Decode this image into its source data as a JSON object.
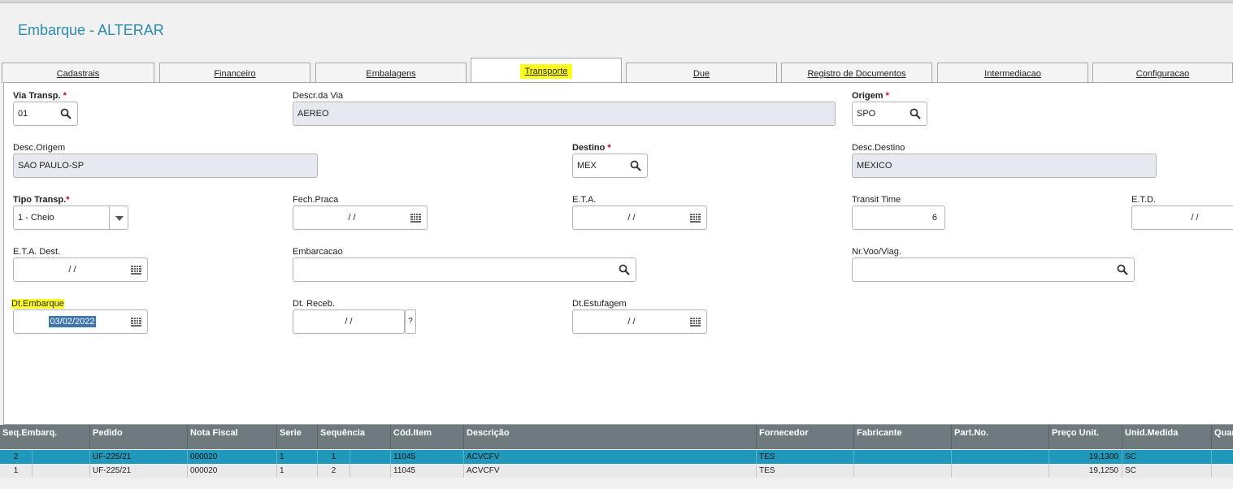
{
  "window": {
    "title": "Embarque - ALTERAR"
  },
  "tabs": [
    {
      "label": "Cadastrais"
    },
    {
      "label": "Financeiro"
    },
    {
      "label": "Embalagens"
    },
    {
      "label": "Transporte"
    },
    {
      "label": "Due"
    },
    {
      "label": "Registro de Documentos"
    },
    {
      "label": "Intermediacao"
    },
    {
      "label": "Configuracao"
    }
  ],
  "form": {
    "via_transp": {
      "label": "Via Transp.",
      "required": "*",
      "value": "01"
    },
    "descr_via": {
      "label": "Descr.da Via",
      "value": "AEREO"
    },
    "origem": {
      "label": "Origem",
      "required": "*",
      "value": "SPO"
    },
    "desc_origem": {
      "label": "Desc.Origem",
      "value": "SAO PAULO-SP"
    },
    "destino": {
      "label": "Destino",
      "required": "*",
      "value": "MEX"
    },
    "desc_destino": {
      "label": "Desc.Destino",
      "value": "MEXICO"
    },
    "tipo_transp": {
      "label": "Tipo Transp.",
      "required": "*",
      "value": "1 - Cheio"
    },
    "fech_praca": {
      "label": "Fech.Praca",
      "value": "/ /"
    },
    "eta": {
      "label": "E.T.A.",
      "value": "/ /"
    },
    "transit_time": {
      "label": "Transit Time",
      "value": "6"
    },
    "etd": {
      "label": "E.T.D.",
      "value": "/ /"
    },
    "eta_dest": {
      "label": "E.T.A. Dest.",
      "value": "/ /"
    },
    "embarcacao": {
      "label": "Embarcacao",
      "value": ""
    },
    "nr_voo": {
      "label": "Nr.Voo/Viag.",
      "value": ""
    },
    "dt_embarque": {
      "label": "Dt.Embarque",
      "value": "03/02/2022"
    },
    "dt_receb": {
      "label": "Dt. Receb.",
      "value": "/ /",
      "help": "?"
    },
    "dt_estufagem": {
      "label": "Dt.Estufagem",
      "value": "/ /"
    }
  },
  "grid": {
    "columns": [
      "Seq.Embarq.",
      "Pedido",
      "Nota Fiscal",
      "Serie",
      "Sequência",
      "Cód.Item",
      "Descrição",
      "Fornecedor",
      "Fabricante",
      "Part.No.",
      "Preço Unit.",
      "Unid.Medida",
      "Quan"
    ],
    "rows": [
      [
        "2",
        "UF-225/21",
        "000020",
        "1",
        "1",
        "11045",
        "ACVCFV",
        "TES",
        "",
        "",
        "19,1300",
        "SC",
        ""
      ],
      [
        "1",
        "UF-225/21",
        "000020",
        "1",
        "2",
        "11045",
        "ACVCFV",
        "TES",
        "",
        "",
        "19,1250",
        "SC",
        ""
      ]
    ]
  },
  "colors": {
    "accent": "#2a8cb0",
    "highlight": "#ffff1f",
    "selected_row": "#1f98bb",
    "grid_header": "#6f7a7f",
    "required": "#d0021b"
  }
}
